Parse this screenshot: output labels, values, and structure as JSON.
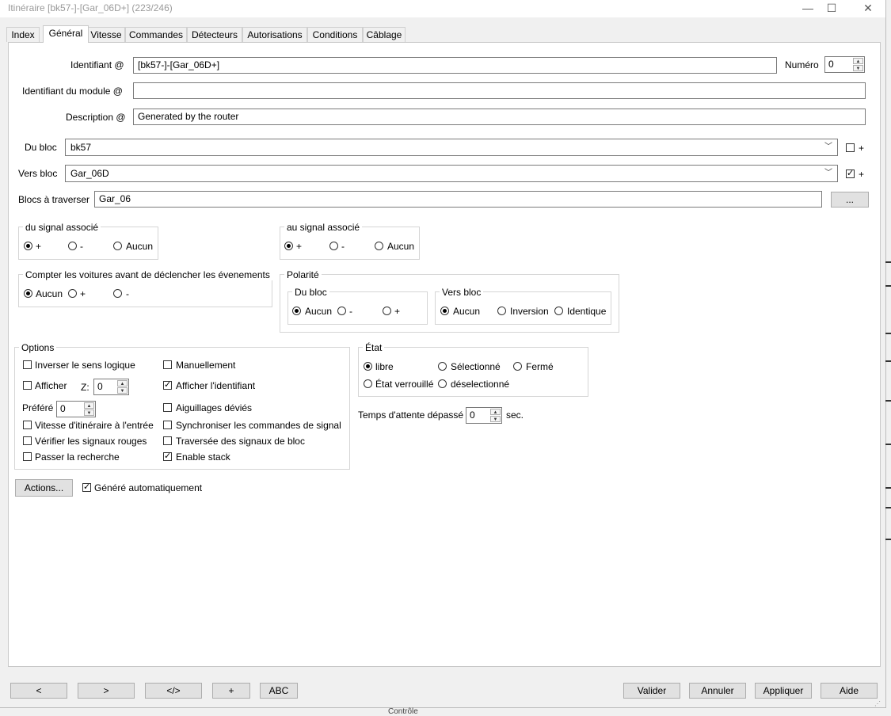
{
  "window": {
    "title": "Itinéraire [bk57-]-[Gar_06D+] (223/246)",
    "controls": {
      "minimize": "—",
      "maximize": "☐",
      "close": "✕"
    }
  },
  "tabs": [
    "Index",
    "Général",
    "Vitesse",
    "Commandes",
    "Détecteurs",
    "Autorisations",
    "Conditions",
    "Câblage"
  ],
  "active_tab": "Général",
  "general": {
    "identifiant_label": "Identifiant @",
    "identifiant_value": "[bk57-]-[Gar_06D+]",
    "numero_label": "Numéro",
    "numero_value": "0",
    "module_label": "Identifiant du module @",
    "module_value": "",
    "description_label": "Description @",
    "description_value": "Generated by the router",
    "du_bloc_label": "Du bloc",
    "du_bloc_value": "bk57",
    "du_bloc_plus": "+",
    "vers_bloc_label": "Vers bloc",
    "vers_bloc_value": "Gar_06D",
    "vers_bloc_plus": "+",
    "blocs_label": "Blocs à traverser",
    "blocs_value": "Gar_06",
    "blocs_button": "..."
  },
  "du_signal": {
    "title": "du signal associé",
    "options": [
      "+",
      "-",
      "Aucun"
    ],
    "selected": "+"
  },
  "au_signal": {
    "title": "au signal associé",
    "options": [
      "+",
      "-",
      "Aucun"
    ],
    "selected": "+"
  },
  "compter": {
    "title": "Compter les voitures avant de déclencher les évenements",
    "options": [
      "Aucun",
      "+",
      "-"
    ],
    "selected": "Aucun"
  },
  "polarite": {
    "title": "Polarité",
    "du_bloc": {
      "title": "Du bloc",
      "options": [
        "Aucun",
        "-",
        "+"
      ],
      "selected": "Aucun"
    },
    "vers_bloc": {
      "title": "Vers bloc",
      "options": [
        "Aucun",
        "Inversion",
        "Identique"
      ],
      "selected": "Aucun"
    }
  },
  "options": {
    "title": "Options",
    "inverser": "Inverser le sens logique",
    "manuellement": "Manuellement",
    "afficher": "Afficher",
    "z_label": "Z:",
    "z_value": "0",
    "afficher_id": "Afficher l'identifiant",
    "prefere": "Préféré",
    "prefere_value": "0",
    "aiguillages": "Aiguillages déviés",
    "vitesse": "Vitesse d'itinéraire à l'entrée",
    "synchroniser": "Synchroniser les commandes de signal",
    "verifier": "Vérifier les signaux rouges",
    "traversee": "Traversée des signaux de bloc",
    "passer": "Passer la recherche",
    "enable_stack": "Enable stack"
  },
  "etat": {
    "title": "État",
    "options": [
      "libre",
      "Sélectionné",
      "Fermé",
      "État verrouillé",
      "déselectionné"
    ],
    "selected": "libre"
  },
  "attente": {
    "label": "Temps d'attente dépassé",
    "value": "0",
    "unit": "sec."
  },
  "actions_button": "Actions...",
  "genere": "Généré automatiquement",
  "footer": {
    "prev": "<",
    "next": ">",
    "code": "</>",
    "plus": "+",
    "abc": "ABC",
    "valider": "Valider",
    "annuler": "Annuler",
    "appliquer": "Appliquer",
    "aide": "Aide"
  },
  "background_text": "Contrôle"
}
